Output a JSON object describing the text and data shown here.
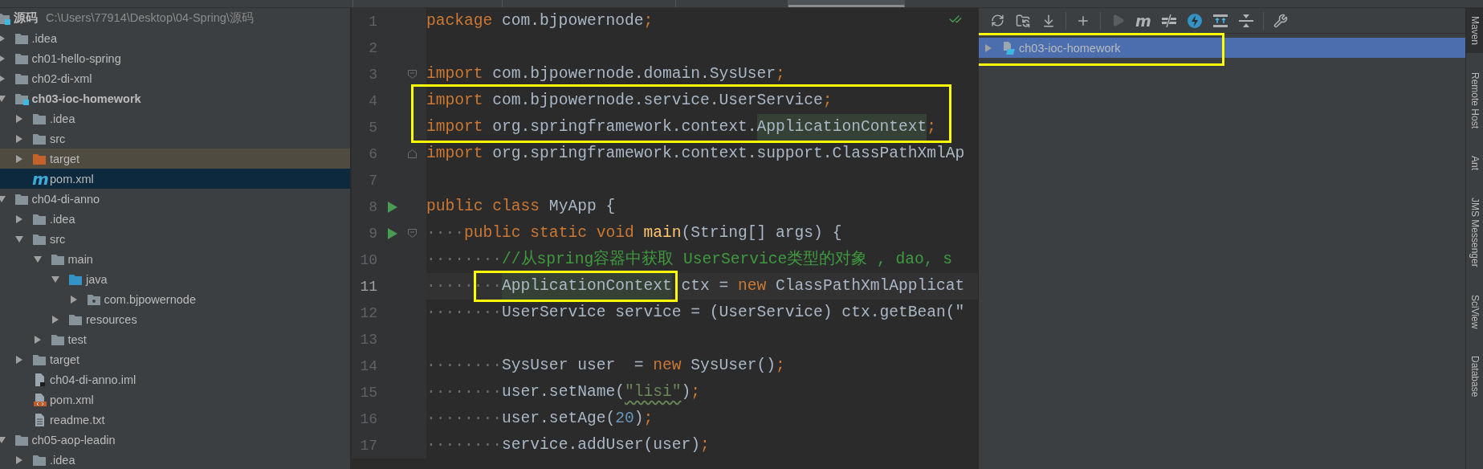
{
  "project_tree": {
    "label": "源码",
    "path": "C:\\Users\\77914\\Desktop\\04-Spring\\源码",
    "kind": "module",
    "selected": false,
    "children": [
      {
        "label": ".idea",
        "kind": "folder",
        "expanded": false,
        "selected": false
      },
      {
        "label": "ch01-hello-spring",
        "kind": "folder",
        "expanded": false,
        "selected": false
      },
      {
        "label": "ch02-di-xml",
        "kind": "folder",
        "expanded": false,
        "selected": false
      },
      {
        "label": "ch03-ioc-homework",
        "kind": "module",
        "expanded": true,
        "selected": false,
        "children": [
          {
            "label": ".idea",
            "kind": "folder",
            "expanded": false,
            "selected": false
          },
          {
            "label": "src",
            "kind": "folder",
            "expanded": false,
            "selected": false
          },
          {
            "label": "target",
            "kind": "excluded",
            "expanded": false,
            "selected": false
          },
          {
            "label": "pom.xml",
            "kind": "maven_pom",
            "glyph": "m",
            "selected": true
          }
        ]
      },
      {
        "label": "ch04-di-anno",
        "kind": "folder",
        "expanded": true,
        "selected": false,
        "children": [
          {
            "label": ".idea",
            "kind": "folder",
            "expanded": false,
            "selected": false
          },
          {
            "label": "src",
            "kind": "folder",
            "expanded": true,
            "selected": false,
            "children": [
              {
                "label": "main",
                "kind": "folder",
                "expanded": true,
                "selected": false,
                "children": [
                  {
                    "label": "java",
                    "kind": "source",
                    "expanded": true,
                    "selected": false,
                    "children": [
                      {
                        "label": "com.bjpowernode",
                        "kind": "package",
                        "expanded": false,
                        "selected": false
                      }
                    ]
                  },
                  {
                    "label": "resources",
                    "kind": "folder",
                    "expanded": false,
                    "selected": false
                  }
                ]
              },
              {
                "label": "test",
                "kind": "folder",
                "expanded": false,
                "selected": false
              }
            ]
          },
          {
            "label": "target",
            "kind": "folder",
            "expanded": false,
            "selected": false
          },
          {
            "label": "ch04-di-anno.iml",
            "kind": "iml",
            "selected": false
          },
          {
            "label": "pom.xml",
            "kind": "xml",
            "selected": false
          },
          {
            "label": "readme.txt",
            "kind": "text",
            "selected": false
          }
        ]
      },
      {
        "label": "ch05-aop-leadin",
        "kind": "folder",
        "expanded": true,
        "selected": false,
        "children": [
          {
            "label": ".idea",
            "kind": "folder",
            "expanded": false,
            "selected": false
          }
        ]
      }
    ]
  },
  "editor": {
    "lines": [
      {
        "number": "1",
        "tokens": [
          {
            "kind": "keyword",
            "text": "package"
          },
          {
            "kind": "plain",
            "text": " com.bjpowernode"
          },
          {
            "kind": "keyword",
            "text": ";"
          }
        ]
      },
      {
        "number": "2"
      },
      {
        "number": "3",
        "fold_start": true,
        "tokens": [
          {
            "kind": "keyword",
            "text": "import"
          },
          {
            "kind": "plain",
            "text": " com.bjpowernode.domain.SysUser"
          },
          {
            "kind": "keyword",
            "text": ";"
          }
        ]
      },
      {
        "number": "4",
        "annotated": true,
        "tokens": [
          {
            "kind": "keyword",
            "text": "import"
          },
          {
            "kind": "plain",
            "text": " com.bjpowernode.service.UserService"
          },
          {
            "kind": "keyword",
            "text": ";"
          }
        ]
      },
      {
        "number": "5",
        "annotated": true,
        "tokens": [
          {
            "kind": "keyword",
            "text": "import"
          },
          {
            "kind": "plain",
            "text": " org.springframework.context."
          },
          {
            "kind": "plain",
            "text": "ApplicationContext",
            "usage": true
          },
          {
            "kind": "keyword",
            "text": ";"
          }
        ]
      },
      {
        "number": "6",
        "fold_end": true,
        "tokens": [
          {
            "kind": "keyword",
            "text": "import"
          },
          {
            "kind": "plain",
            "text": " org.springframework.context.support.ClassPathXmlAp"
          }
        ]
      },
      {
        "number": "7"
      },
      {
        "number": "8",
        "runnable": true,
        "tokens": [
          {
            "kind": "keyword",
            "text": "public class"
          },
          {
            "kind": "plain",
            "text": " MyApp {"
          }
        ]
      },
      {
        "number": "9",
        "runnable": true,
        "fold_start": true,
        "tokens": [
          {
            "kind": "whitespace",
            "text": "····"
          },
          {
            "kind": "keyword",
            "text": "public static void"
          },
          {
            "kind": "method",
            "text": " main"
          },
          {
            "kind": "plain",
            "text": "(String[] args) {"
          }
        ]
      },
      {
        "number": "10",
        "tokens": [
          {
            "kind": "whitespace",
            "text": "········"
          },
          {
            "kind": "comment",
            "text": "//从spring容器中获取 UserService类型的对象 , dao, s"
          }
        ]
      },
      {
        "number": "11",
        "current": true,
        "tokens": [
          {
            "kind": "whitespace",
            "text": "········"
          },
          {
            "kind": "plain",
            "text": "ApplicationContext",
            "usage": true,
            "annotated": true
          },
          {
            "kind": "plain",
            "text": " ctx = "
          },
          {
            "kind": "keyword",
            "text": "new"
          },
          {
            "kind": "plain",
            "text": " ClassPathXmlApplicat"
          }
        ]
      },
      {
        "number": "12",
        "tokens": [
          {
            "kind": "whitespace",
            "text": "········"
          },
          {
            "kind": "plain",
            "text": "UserService service = (UserService) ctx.getBean(\""
          }
        ]
      },
      {
        "number": "13"
      },
      {
        "number": "14",
        "tokens": [
          {
            "kind": "whitespace",
            "text": "········"
          },
          {
            "kind": "plain",
            "text": "SysUser user  = "
          },
          {
            "kind": "keyword",
            "text": "new"
          },
          {
            "kind": "plain",
            "text": " SysUser()"
          },
          {
            "kind": "keyword",
            "text": ";"
          }
        ]
      },
      {
        "number": "15",
        "tokens": [
          {
            "kind": "whitespace",
            "text": "········"
          },
          {
            "kind": "plain",
            "text": "user.setName("
          },
          {
            "kind": "string",
            "text": "\"lisi\"",
            "typo": true
          },
          {
            "kind": "plain",
            "text": ")"
          },
          {
            "kind": "keyword",
            "text": ";"
          }
        ]
      },
      {
        "number": "16",
        "tokens": [
          {
            "kind": "whitespace",
            "text": "········"
          },
          {
            "kind": "plain",
            "text": "user.setAge("
          },
          {
            "kind": "number",
            "text": "20"
          },
          {
            "kind": "plain",
            "text": ")"
          },
          {
            "kind": "keyword",
            "text": ";"
          }
        ]
      },
      {
        "number": "17",
        "tokens": [
          {
            "kind": "whitespace",
            "text": "········"
          },
          {
            "kind": "plain",
            "text": "service.addUser(user)"
          },
          {
            "kind": "keyword",
            "text": ";"
          }
        ]
      }
    ]
  },
  "maven": {
    "toolbar": {
      "run_disabled": true,
      "goal_glyph": "m"
    },
    "projects": [
      {
        "label": "ch03-ioc-homework",
        "expanded": false,
        "selected": true,
        "annotated": true
      }
    ]
  },
  "tool_windows": [
    {
      "label": "Maven",
      "selected": true
    },
    {
      "label": "Remote Host",
      "selected": false
    },
    {
      "label": "Ant",
      "selected": false
    },
    {
      "label": "JMS Messenger",
      "selected": false
    },
    {
      "label": "SciView",
      "selected": false
    },
    {
      "label": "Database",
      "selected": false
    }
  ]
}
